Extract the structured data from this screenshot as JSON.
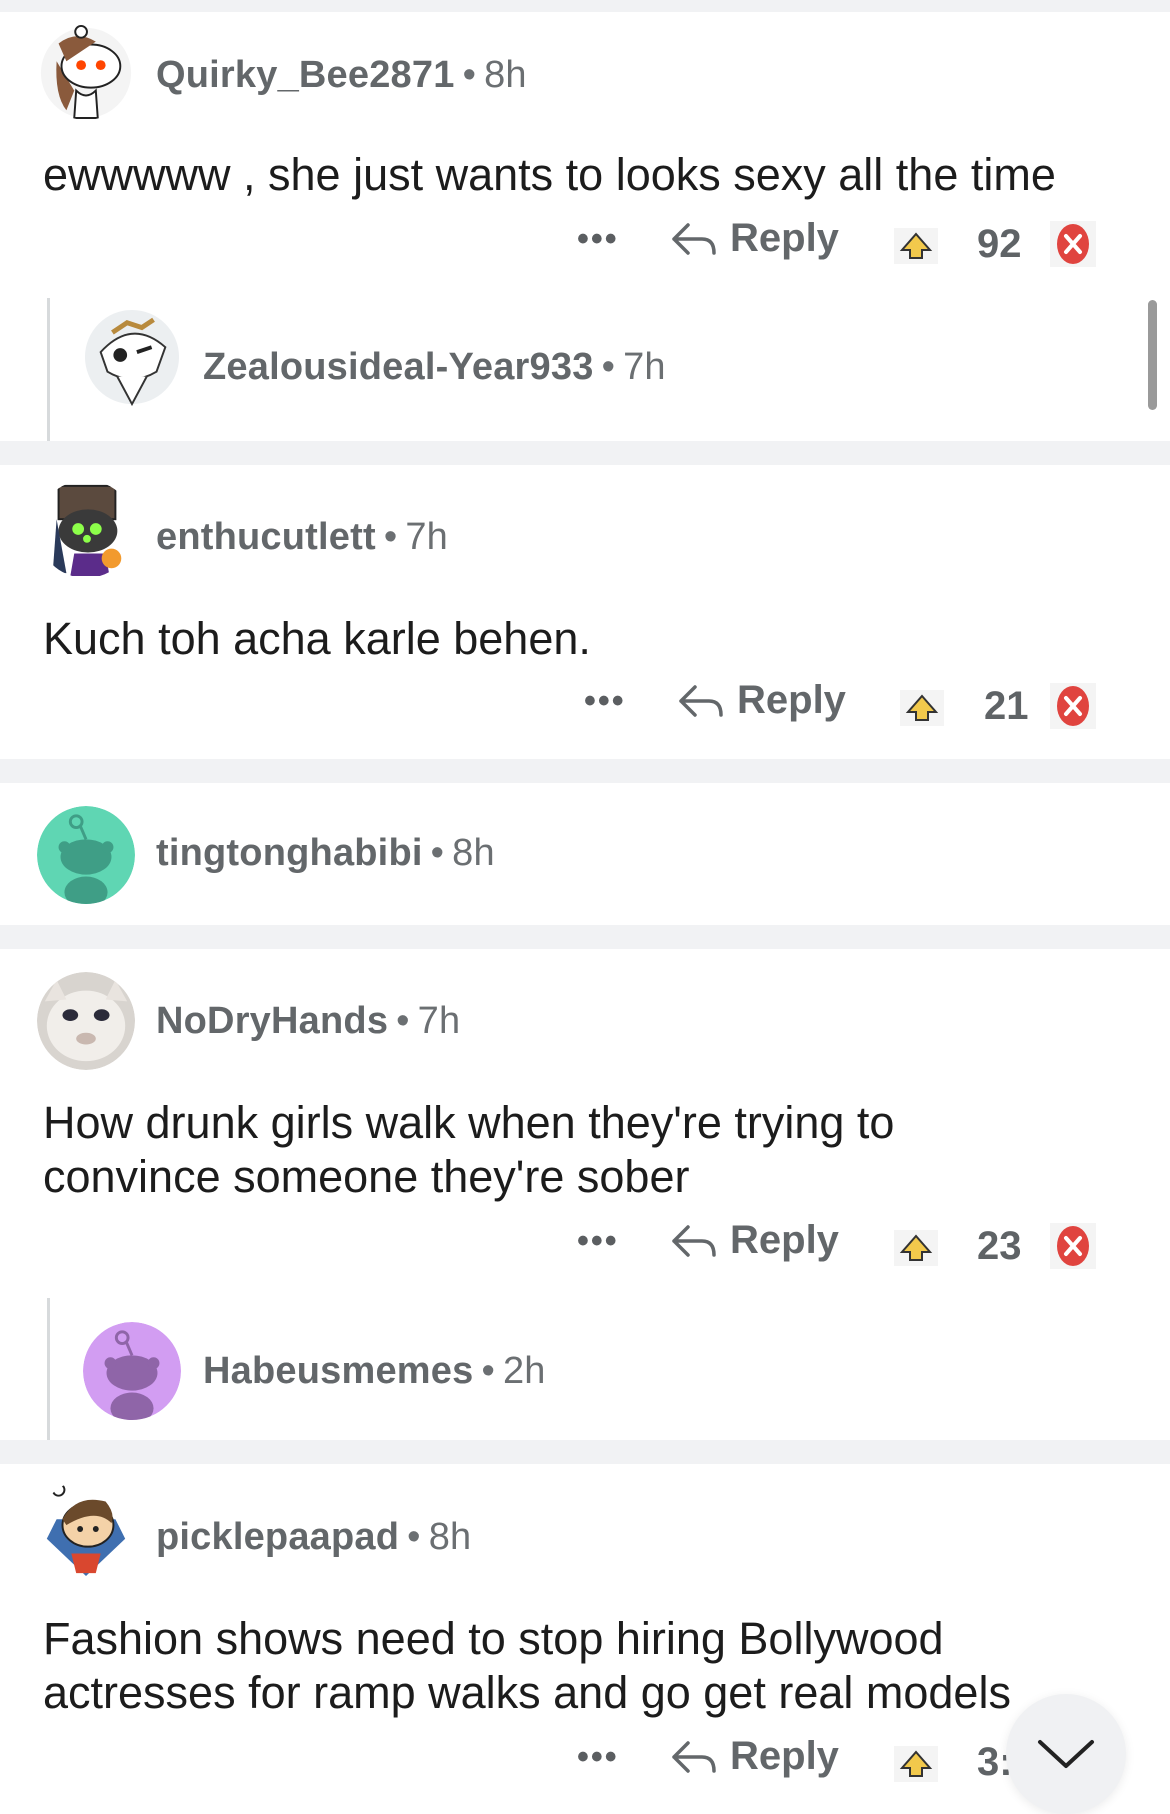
{
  "comments": [
    {
      "user": "Quirky_Bee2871",
      "age": "8h",
      "text": "ewwwww , she just wants to looks sexy all the time",
      "more": "•••",
      "reply": "Reply",
      "score": "92"
    },
    {
      "user": "Zealousideal-Year933",
      "age": "7h"
    },
    {
      "user": "enthucutlett",
      "age": "7h",
      "text": "Kuch toh acha karle behen.",
      "more": "•••",
      "reply": "Reply",
      "score": "21"
    },
    {
      "user": "tingtonghabibi",
      "age": "8h"
    },
    {
      "user": "NoDryHands",
      "age": "7h",
      "text": "How drunk girls walk when they're trying to convince someone they're sober",
      "more": "•••",
      "reply": "Reply",
      "score": "23"
    },
    {
      "user": "Habeusmemes",
      "age": "2h"
    },
    {
      "user": "picklepaapad",
      "age": "8h",
      "text": "Fashion shows need to stop hiring Bollywood actresses for ramp walks and go get real models",
      "more": "•••",
      "reply": "Reply",
      "score": "3:"
    }
  ],
  "separator": "•",
  "icons": {
    "reply": "reply-arrow-icon",
    "upvote": "award-upvote-icon",
    "downvote": "red-x-downvote-icon",
    "collapse": "chevron-down-icon"
  },
  "colors": {
    "downvote": "#e0443f",
    "upvote": "#f2c94c",
    "tingtong_avatar": "#5fd6b3",
    "habeus_avatar": "#d29df2"
  }
}
